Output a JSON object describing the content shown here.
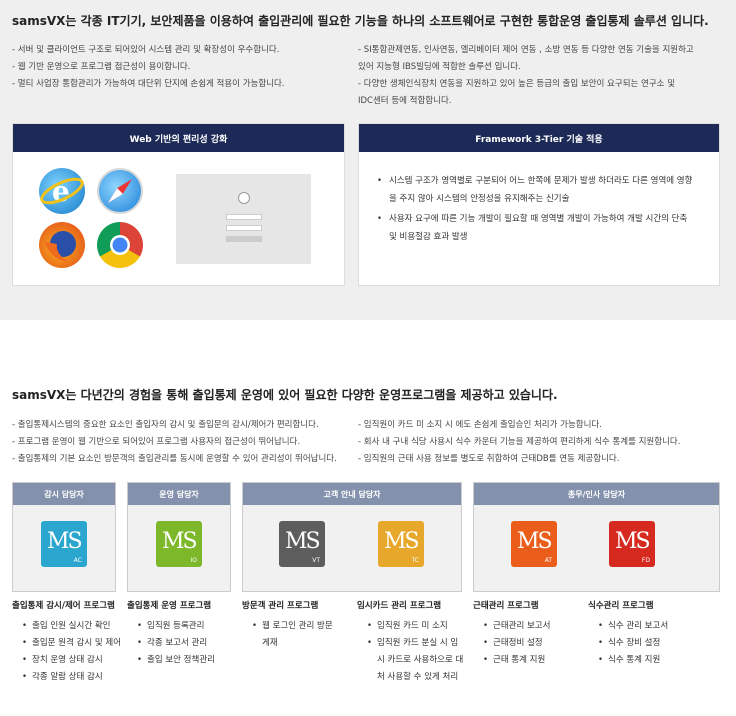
{
  "section1": {
    "headline": "samsVX는 각종 IT기기, 보안제품을 이용하여 출입관리에 필요한 기능을 하나의 소프트웨어로 구현한 통합운영 출입통제 솔루션 입니다.",
    "left_lines": [
      "- 서버 및 클라이언트 구조로 되어있어 시스템 관리 및 확장성이 우수합니다.",
      "- 웹 기반 운영으로 프로그램 접근성이 용이합니다.",
      "- 멀티 사업장 통합관리가 가능하여 대단위 단지에 손쉽게 적용이 가능합니다."
    ],
    "right_lines": [
      "- SI통합관제연동, 인사연동, 엘리베이터 제어 연동 , 소방 연동 등 다양한 연동 기술을 지원하고",
      "있어 지능형 IBS빌딩에 적합한 솔루션 입니다.",
      "- 다양한 생체인식장치 연동을 지원하고 있어 높은 등급의 출입 보안이 요구되는 연구소 및",
      "IDC센터 등에 적합합니다."
    ],
    "panel_web_title": "Web 기반의 편리성 강화",
    "panel_fw_title": "Framework 3-Tier 기술 적용",
    "fw_items": [
      "시스템 구조가 영역별로 구분되어 어느 한쪽에 문제가 발생 하더라도 다른 영역에 영향을 주지 않아 시스템의 안정성을 유지해주는 신기술",
      "사용자 요구에 따른 기능 개발이 필요할 때 영역별 개발이 가능하여 개발 시간의 단축 및 비용절감 효과 발생"
    ]
  },
  "section2": {
    "headline": "samsVX는 다년간의 경험을 통해 출입통제 운영에 있어 필요한 다양한 운영프로그램을 제공하고 있습니다.",
    "left_lines": [
      "- 출입통제시스템의 중요한 요소인 출입자의 감시 및 출입문의 감시/제어가 편리합니다.",
      "- 프로그램 운영이 웹 기반으로 되어있어 프로그램 사용자의 접근성이 뛰어납니다.",
      "- 출입통제의 기본 요소인 방문객의 출입관리를 동시에 운영할 수 있어 관리성이 뛰어납니다."
    ],
    "right_lines": [
      "- 임직원이 카드 미 소지 시 에도 손쉽게 출입승인 처리가 가능합니다.",
      "- 회사 내 구내 식당 사용시 식수 카운터 기능을 제공하여 편리하게 식수 통계를 지원합니다.",
      "- 임직원의 근태 사용 정보를 별도로 취합하여 근태DB를 연동 제공합니다."
    ],
    "cards": [
      {
        "title": "감시 담당자"
      },
      {
        "title": "운영 담당자"
      },
      {
        "title": "고객 안내 담당자"
      },
      {
        "title": "총무/인사 담당자"
      }
    ],
    "tiles": [
      {
        "label": "MS",
        "code": "AC",
        "color": "#2aa6cf"
      },
      {
        "label": "MS",
        "code": "IO",
        "color": "#7cb82a"
      },
      {
        "label": "MS",
        "code": "VT",
        "color": "#5d5d5d"
      },
      {
        "label": "MS",
        "code": "TC",
        "color": "#e6a72a"
      },
      {
        "label": "MS",
        "code": "AT",
        "color": "#ea5d1b"
      },
      {
        "label": "MS",
        "code": "FD",
        "color": "#d62a20"
      }
    ],
    "programs": [
      {
        "title": "출입통제 감시/제어 프로그램",
        "items": [
          "출입 인원 실시간 확인",
          "출입문 원격 감시 및 제어",
          "장치 운영 상태 감시",
          "각종 알람 상태 감시"
        ]
      },
      {
        "title": "출입통제 운영 프로그램",
        "items": [
          "임직원 등록관리",
          "각종 보고서 관리",
          "출입 보안 정책관리"
        ]
      },
      {
        "title": "방문객 관리 프로그램",
        "items": [
          "웹 로그인 관리 방문게재"
        ]
      },
      {
        "title": "임시카드 관리 프로그램",
        "items": [
          "임직원 카드 미 소지",
          "임직원 카드 분실 시 임시 카드로 사용하으로 대처 사용할 수 있게 처리"
        ]
      },
      {
        "title": "근태관리 프로그램",
        "items": [
          "근태관리 보고서",
          "근태정비 설정",
          "근태 통계 지원"
        ]
      },
      {
        "title": "식수관리 프로그램",
        "items": [
          "식수 관리 보고서",
          "식수 장비 설정",
          "식수 통계 지원"
        ]
      }
    ]
  }
}
